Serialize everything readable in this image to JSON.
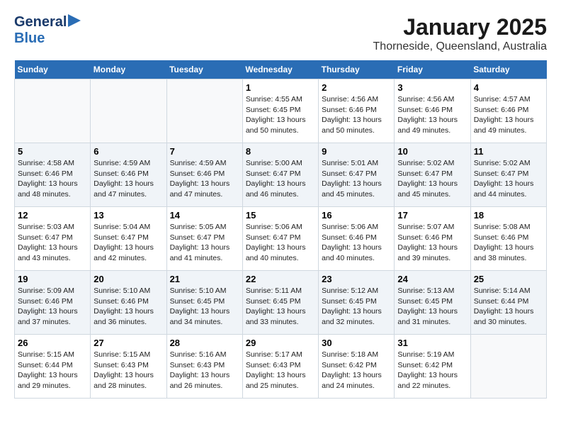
{
  "logo": {
    "line1": "General",
    "line2": "Blue"
  },
  "title": "January 2025",
  "subtitle": "Thorneside, Queensland, Australia",
  "days_header": [
    "Sunday",
    "Monday",
    "Tuesday",
    "Wednesday",
    "Thursday",
    "Friday",
    "Saturday"
  ],
  "weeks": [
    [
      {
        "day": "",
        "info": ""
      },
      {
        "day": "",
        "info": ""
      },
      {
        "day": "",
        "info": ""
      },
      {
        "day": "1",
        "info": "Sunrise: 4:55 AM\nSunset: 6:45 PM\nDaylight: 13 hours\nand 50 minutes."
      },
      {
        "day": "2",
        "info": "Sunrise: 4:56 AM\nSunset: 6:46 PM\nDaylight: 13 hours\nand 50 minutes."
      },
      {
        "day": "3",
        "info": "Sunrise: 4:56 AM\nSunset: 6:46 PM\nDaylight: 13 hours\nand 49 minutes."
      },
      {
        "day": "4",
        "info": "Sunrise: 4:57 AM\nSunset: 6:46 PM\nDaylight: 13 hours\nand 49 minutes."
      }
    ],
    [
      {
        "day": "5",
        "info": "Sunrise: 4:58 AM\nSunset: 6:46 PM\nDaylight: 13 hours\nand 48 minutes."
      },
      {
        "day": "6",
        "info": "Sunrise: 4:59 AM\nSunset: 6:46 PM\nDaylight: 13 hours\nand 47 minutes."
      },
      {
        "day": "7",
        "info": "Sunrise: 4:59 AM\nSunset: 6:46 PM\nDaylight: 13 hours\nand 47 minutes."
      },
      {
        "day": "8",
        "info": "Sunrise: 5:00 AM\nSunset: 6:47 PM\nDaylight: 13 hours\nand 46 minutes."
      },
      {
        "day": "9",
        "info": "Sunrise: 5:01 AM\nSunset: 6:47 PM\nDaylight: 13 hours\nand 45 minutes."
      },
      {
        "day": "10",
        "info": "Sunrise: 5:02 AM\nSunset: 6:47 PM\nDaylight: 13 hours\nand 45 minutes."
      },
      {
        "day": "11",
        "info": "Sunrise: 5:02 AM\nSunset: 6:47 PM\nDaylight: 13 hours\nand 44 minutes."
      }
    ],
    [
      {
        "day": "12",
        "info": "Sunrise: 5:03 AM\nSunset: 6:47 PM\nDaylight: 13 hours\nand 43 minutes."
      },
      {
        "day": "13",
        "info": "Sunrise: 5:04 AM\nSunset: 6:47 PM\nDaylight: 13 hours\nand 42 minutes."
      },
      {
        "day": "14",
        "info": "Sunrise: 5:05 AM\nSunset: 6:47 PM\nDaylight: 13 hours\nand 41 minutes."
      },
      {
        "day": "15",
        "info": "Sunrise: 5:06 AM\nSunset: 6:47 PM\nDaylight: 13 hours\nand 40 minutes."
      },
      {
        "day": "16",
        "info": "Sunrise: 5:06 AM\nSunset: 6:46 PM\nDaylight: 13 hours\nand 40 minutes."
      },
      {
        "day": "17",
        "info": "Sunrise: 5:07 AM\nSunset: 6:46 PM\nDaylight: 13 hours\nand 39 minutes."
      },
      {
        "day": "18",
        "info": "Sunrise: 5:08 AM\nSunset: 6:46 PM\nDaylight: 13 hours\nand 38 minutes."
      }
    ],
    [
      {
        "day": "19",
        "info": "Sunrise: 5:09 AM\nSunset: 6:46 PM\nDaylight: 13 hours\nand 37 minutes."
      },
      {
        "day": "20",
        "info": "Sunrise: 5:10 AM\nSunset: 6:46 PM\nDaylight: 13 hours\nand 36 minutes."
      },
      {
        "day": "21",
        "info": "Sunrise: 5:10 AM\nSunset: 6:45 PM\nDaylight: 13 hours\nand 34 minutes."
      },
      {
        "day": "22",
        "info": "Sunrise: 5:11 AM\nSunset: 6:45 PM\nDaylight: 13 hours\nand 33 minutes."
      },
      {
        "day": "23",
        "info": "Sunrise: 5:12 AM\nSunset: 6:45 PM\nDaylight: 13 hours\nand 32 minutes."
      },
      {
        "day": "24",
        "info": "Sunrise: 5:13 AM\nSunset: 6:45 PM\nDaylight: 13 hours\nand 31 minutes."
      },
      {
        "day": "25",
        "info": "Sunrise: 5:14 AM\nSunset: 6:44 PM\nDaylight: 13 hours\nand 30 minutes."
      }
    ],
    [
      {
        "day": "26",
        "info": "Sunrise: 5:15 AM\nSunset: 6:44 PM\nDaylight: 13 hours\nand 29 minutes."
      },
      {
        "day": "27",
        "info": "Sunrise: 5:15 AM\nSunset: 6:43 PM\nDaylight: 13 hours\nand 28 minutes."
      },
      {
        "day": "28",
        "info": "Sunrise: 5:16 AM\nSunset: 6:43 PM\nDaylight: 13 hours\nand 26 minutes."
      },
      {
        "day": "29",
        "info": "Sunrise: 5:17 AM\nSunset: 6:43 PM\nDaylight: 13 hours\nand 25 minutes."
      },
      {
        "day": "30",
        "info": "Sunrise: 5:18 AM\nSunset: 6:42 PM\nDaylight: 13 hours\nand 24 minutes."
      },
      {
        "day": "31",
        "info": "Sunrise: 5:19 AM\nSunset: 6:42 PM\nDaylight: 13 hours\nand 22 minutes."
      },
      {
        "day": "",
        "info": ""
      }
    ]
  ]
}
